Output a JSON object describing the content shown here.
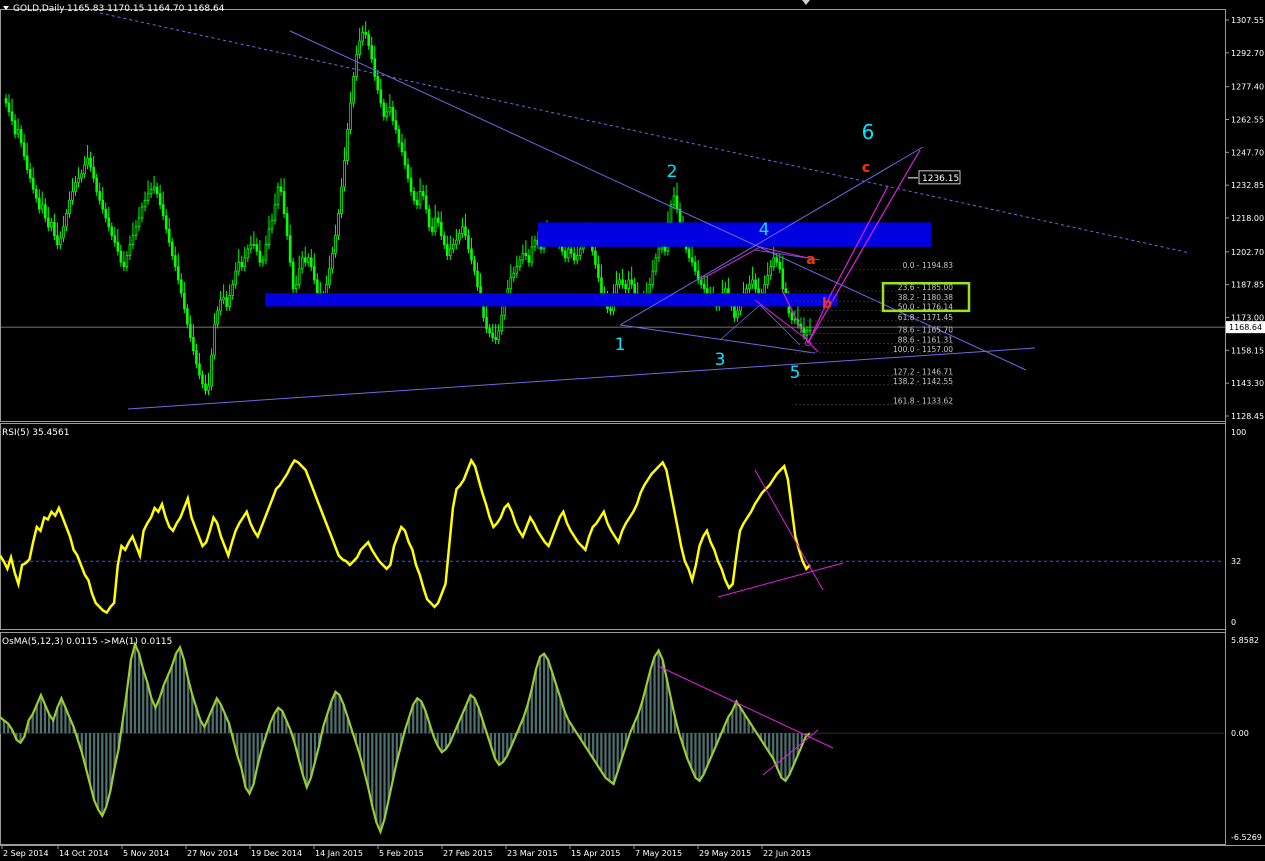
{
  "header": {
    "symbol": "GOLD,Daily",
    "ohlc": "1165.83 1170.15 1164.70 1168.64"
  },
  "colors": {
    "bull_candle": "#00ff00",
    "rsi_line": "#ffff00",
    "osma_line": "#9acd32",
    "zone_blue": "#0000e0",
    "trend_line": "#6a6ae6",
    "wave_label": "#00e5ff",
    "abc_label": "#ff3300",
    "magenta": "#e020e0",
    "fib_text": "#c8c8c8",
    "target_box": "#9be21f"
  },
  "price_axis": {
    "ticks": [
      "1307.55",
      "1292.70",
      "1277.40",
      "1262.55",
      "1247.70",
      "1232.85",
      "1218.00",
      "1202.70",
      "1187.85",
      "1173.00",
      "1158.15",
      "1143.30",
      "1128.45"
    ],
    "current_price": "1168.64",
    "target_price": "1236.15"
  },
  "rsi_panel": {
    "label": "RSI(5) 35.4561",
    "ticks": [
      "100",
      "32",
      "0"
    ],
    "level": 32,
    "values": [
      35,
      32,
      28,
      34,
      26,
      20,
      30,
      31,
      33,
      42,
      50,
      48,
      55,
      54,
      58,
      56,
      60,
      55,
      50,
      45,
      38,
      35,
      30,
      25,
      22,
      15,
      10,
      8,
      6,
      5,
      8,
      10,
      30,
      40,
      38,
      42,
      45,
      40,
      35,
      48,
      52,
      55,
      60,
      58,
      62,
      55,
      50,
      48,
      52,
      55,
      60,
      65,
      55,
      50,
      45,
      40,
      42,
      48,
      55,
      52,
      45,
      40,
      35,
      42,
      48,
      52,
      55,
      58,
      52,
      48,
      45,
      50,
      55,
      60,
      65,
      70,
      72,
      75,
      78,
      82,
      85,
      84,
      82,
      80,
      75,
      70,
      65,
      60,
      55,
      50,
      45,
      40,
      35,
      33,
      32,
      30,
      32,
      34,
      38,
      40,
      42,
      38,
      35,
      32,
      30,
      28,
      30,
      40,
      45,
      50,
      48,
      42,
      38,
      30,
      25,
      18,
      12,
      10,
      8,
      10,
      15,
      20,
      40,
      60,
      70,
      72,
      75,
      80,
      85,
      82,
      75,
      68,
      62,
      55,
      50,
      52,
      55,
      60,
      62,
      58,
      52,
      48,
      45,
      50,
      55,
      52,
      48,
      45,
      42,
      40,
      45,
      50,
      55,
      58,
      52,
      48,
      45,
      42,
      40,
      38,
      45,
      50,
      52,
      55,
      58,
      52,
      48,
      45,
      42,
      48,
      52,
      55,
      58,
      62,
      68,
      72,
      75,
      78,
      80,
      82,
      84,
      80,
      70,
      60,
      50,
      40,
      32,
      28,
      22,
      30,
      40,
      45,
      48,
      42,
      38,
      32,
      28,
      22,
      18,
      20,
      35,
      48,
      52,
      55,
      58,
      62,
      65,
      68,
      70,
      72,
      75,
      78,
      80,
      82,
      75,
      60,
      45,
      38,
      32,
      28,
      30
    ],
    "trend_lines": [
      {
        "p1": [
          0.0,
          0.0
        ],
        "p2": [
          0.0,
          0.0
        ]
      }
    ]
  },
  "osma_panel": {
    "label": "OsMA(5,12,3) 0.0115  ->MA(1) 0.0115",
    "ticks": [
      "5.8582",
      "0.00",
      "-6.5269"
    ],
    "values": [
      1.0,
      0.8,
      0.6,
      0.2,
      -0.4,
      -0.6,
      -0.2,
      0.8,
      1.2,
      1.8,
      2.4,
      1.8,
      1.2,
      0.8,
      1.6,
      2.2,
      1.6,
      1.0,
      0.4,
      -0.4,
      -1.2,
      -2.2,
      -3.2,
      -4.2,
      -4.8,
      -5.2,
      -4.6,
      -3.6,
      -2.2,
      -1.0,
      0.8,
      2.6,
      4.6,
      5.6,
      5.0,
      4.0,
      3.2,
      2.2,
      1.6,
      2.2,
      3.0,
      3.6,
      4.2,
      5.0,
      5.4,
      4.6,
      3.4,
      2.4,
      1.6,
      0.8,
      0.4,
      1.0,
      1.6,
      2.2,
      1.8,
      1.2,
      0.6,
      -0.4,
      -1.4,
      -2.2,
      -3.4,
      -3.8,
      -3.2,
      -2.0,
      -1.0,
      -0.2,
      0.6,
      1.2,
      1.6,
      1.4,
      0.8,
      0.2,
      -0.6,
      -1.6,
      -2.6,
      -3.4,
      -2.8,
      -1.8,
      -0.8,
      0.4,
      1.2,
      2.0,
      2.6,
      2.4,
      1.8,
      1.0,
      0.2,
      -0.6,
      -1.4,
      -2.4,
      -3.4,
      -4.6,
      -5.6,
      -6.2,
      -5.4,
      -4.2,
      -3.0,
      -1.8,
      -0.8,
      0.2,
      1.0,
      1.8,
      2.2,
      2.0,
      1.4,
      0.6,
      -0.2,
      -0.8,
      -1.2,
      -1.0,
      -0.6,
      0.0,
      0.6,
      1.2,
      1.8,
      2.4,
      2.2,
      1.6,
      0.8,
      0.0,
      -0.8,
      -1.6,
      -2.0,
      -1.8,
      -1.4,
      -0.8,
      -0.2,
      0.4,
      1.0,
      1.8,
      2.8,
      4.0,
      4.8,
      5.0,
      4.6,
      3.8,
      3.0,
      2.2,
      1.4,
      0.8,
      0.4,
      0.0,
      -0.4,
      -0.8,
      -1.2,
      -1.6,
      -2.0,
      -2.4,
      -2.8,
      -3.0,
      -3.2,
      -2.4,
      -1.6,
      -0.8,
      0.0,
      0.6,
      1.2,
      2.0,
      3.0,
      4.0,
      4.8,
      5.2,
      4.6,
      3.4,
      2.2,
      1.0,
      0.0,
      -0.8,
      -1.6,
      -2.2,
      -2.8,
      -3.0,
      -2.6,
      -2.0,
      -1.4,
      -0.8,
      -0.2,
      0.4,
      1.0,
      1.4,
      2.0,
      1.6,
      1.2,
      0.8,
      0.4,
      0.0,
      -0.4,
      -0.8,
      -1.2,
      -1.6,
      -2.2,
      -2.8,
      -3.0,
      -2.6,
      -2.0,
      -1.4,
      -0.8,
      -0.2,
      0.0
    ]
  },
  "date_axis": [
    "2 Sep 2014",
    "14 Oct 2014",
    "5 Nov 2014",
    "27 Nov 2014",
    "19 Dec 2014",
    "14 Jan 2015",
    "5 Feb 2015",
    "27 Feb 2015",
    "23 Mar 2015",
    "15 Apr 2015",
    "7 May 2015",
    "29 May 2015",
    "22 Jun 2015"
  ],
  "wave_labels": [
    "1",
    "2",
    "3",
    "4",
    "5",
    "6"
  ],
  "abc_labels": [
    "a",
    "b",
    "c"
  ],
  "fib_levels": [
    {
      "label": "0.0 - 1194.83",
      "price": 1194.83
    },
    {
      "label": "23.6 - 1185.00",
      "price": 1185.0
    },
    {
      "label": "38.2 - 1180.38",
      "price": 1180.38
    },
    {
      "label": "50.0 - 1176.14",
      "price": 1176.14
    },
    {
      "label": "61.8 - 1171.45",
      "price": 1171.45
    },
    {
      "label": "78.6 - 1165.70",
      "price": 1165.7
    },
    {
      "label": "88.6 - 1161.31",
      "price": 1161.31
    },
    {
      "label": "100.0 - 1157.00",
      "price": 1157.0
    },
    {
      "label": "127.2 - 1146.71",
      "price": 1146.71
    },
    {
      "label": "138.2 - 1142.55",
      "price": 1142.55
    },
    {
      "label": "161.8 - 1133.62",
      "price": 1133.62
    }
  ],
  "chart_data": {
    "type": "candlestick",
    "title": "GOLD,Daily",
    "ylim": [
      1126.0,
      1313.0
    ],
    "close": [
      1270,
      1266,
      1262,
      1256,
      1258,
      1252,
      1246,
      1240,
      1236,
      1231,
      1227,
      1222,
      1224,
      1218,
      1214,
      1216,
      1210,
      1206,
      1209,
      1214,
      1220,
      1226,
      1230,
      1234,
      1236,
      1238,
      1242,
      1245,
      1241,
      1236,
      1230,
      1226,
      1222,
      1218,
      1214,
      1210,
      1207,
      1203,
      1198,
      1196,
      1201,
      1206,
      1210,
      1214,
      1218,
      1223,
      1226,
      1229,
      1231,
      1232,
      1229,
      1224,
      1219,
      1213,
      1207,
      1201,
      1196,
      1190,
      1184,
      1177,
      1170,
      1164,
      1158,
      1152,
      1147,
      1143,
      1140,
      1142,
      1156,
      1170,
      1176,
      1181,
      1182,
      1178,
      1183,
      1188,
      1194,
      1198,
      1196,
      1200,
      1204,
      1206,
      1206,
      1203,
      1198,
      1199,
      1206,
      1213,
      1217,
      1224,
      1232,
      1230,
      1220,
      1210,
      1198,
      1186,
      1188,
      1195,
      1200,
      1198,
      1200,
      1196,
      1190,
      1184,
      1181,
      1183,
      1188,
      1195,
      1202,
      1210,
      1220,
      1232,
      1244,
      1258,
      1270,
      1282,
      1292,
      1298,
      1302,
      1301,
      1296,
      1290,
      1282,
      1276,
      1270,
      1264,
      1266,
      1268,
      1262,
      1258,
      1252,
      1248,
      1242,
      1236,
      1230,
      1226,
      1224,
      1230,
      1228,
      1222,
      1214,
      1212,
      1218,
      1216,
      1210,
      1206,
      1201,
      1204,
      1206,
      1208,
      1211,
      1214,
      1210,
      1204,
      1199,
      1194,
      1187,
      1180,
      1173,
      1168,
      1166,
      1164,
      1163,
      1167,
      1174,
      1181,
      1186,
      1191,
      1193,
      1196,
      1199,
      1202,
      1201,
      1198,
      1205,
      1208,
      1206,
      1204,
      1210,
      1212,
      1210,
      1208,
      1207,
      1206,
      1203,
      1200,
      1204,
      1202,
      1199,
      1201,
      1204,
      1207,
      1210,
      1208,
      1203,
      1197,
      1191,
      1184,
      1180,
      1177,
      1176,
      1184,
      1188,
      1190,
      1188,
      1186,
      1190,
      1188,
      1184,
      1182,
      1181,
      1180,
      1183,
      1188,
      1194,
      1200,
      1204,
      1205,
      1203,
      1216,
      1224,
      1228,
      1222,
      1214,
      1208,
      1204,
      1200,
      1198,
      1194,
      1190,
      1188,
      1186,
      1184,
      1182,
      1180,
      1178,
      1180,
      1184,
      1186,
      1182,
      1178,
      1173,
      1176,
      1180,
      1184,
      1186,
      1188,
      1190,
      1186,
      1182,
      1184,
      1188,
      1192,
      1196,
      1200,
      1198,
      1195,
      1186,
      1180,
      1175,
      1172,
      1172,
      1170,
      1168,
      1165,
      1167,
      1168.64
    ],
    "series_note": "",
    "dates": [
      "2 Sep 2014",
      "14 Oct 2014",
      "5 Nov 2014",
      "27 Nov 2014",
      "19 Dec 2014",
      "14 Jan 2015",
      "5 Feb 2015",
      "27 Feb 2015",
      "23 Mar 2015",
      "15 Apr 2015",
      "7 May 2015",
      "29 May 2015",
      "22 Jun 2015"
    ]
  }
}
